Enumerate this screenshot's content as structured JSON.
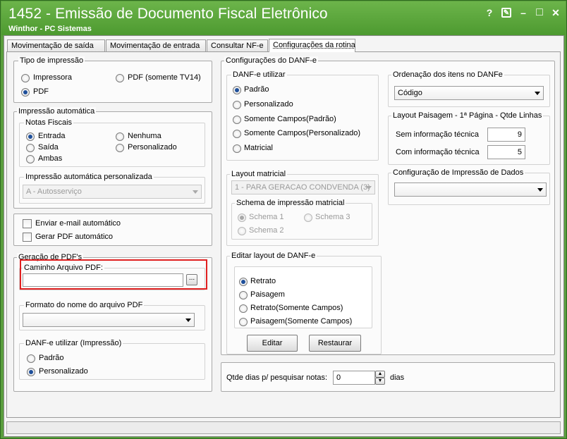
{
  "window": {
    "title": "1452 - Emissão de Documento Fiscal Eletrônico",
    "subtitle": "Winthor - PC Sistemas",
    "help": "?",
    "edit_icon": "✎",
    "minimize": "–",
    "maximize": "□",
    "close": "✕"
  },
  "tabs": [
    {
      "label": "Movimentação de saída"
    },
    {
      "label": "Movimentação de entrada"
    },
    {
      "label": "Consultar NF-e"
    },
    {
      "label": "Configurações da rotina"
    }
  ],
  "tipo_impressao": {
    "caption": "Tipo de impressão",
    "options": [
      {
        "label": "Impressora",
        "selected": false
      },
      {
        "label": "PDF (somente TV14)",
        "selected": false
      },
      {
        "label": "PDF",
        "selected": true
      }
    ]
  },
  "impressao_automatica": {
    "caption": "Impressão automática",
    "notas_caption": "Notas Fiscais",
    "options": [
      {
        "label": "Entrada",
        "selected": true
      },
      {
        "label": "Nenhuma",
        "selected": false
      },
      {
        "label": "Saída",
        "selected": false
      },
      {
        "label": "Personalizado",
        "selected": false
      },
      {
        "label": "Ambas",
        "selected": false
      }
    ],
    "personalizada_caption": "Impressão automática personalizada",
    "personalizada_value": "A - Autosserviço"
  },
  "email": {
    "enviar_label": "Enviar e-mail automático",
    "gerar_label": "Gerar PDF automático"
  },
  "geracao_pdf": {
    "caption": "Geração de PDF's",
    "caminho_caption": "Caminho Arquivo PDF:",
    "caminho_value": "",
    "browse_label": "...",
    "formato_caption": "Formato do nome do arquivo PDF",
    "formato_value": "",
    "danfe_caption": "DANF-e utilizar (Impressão)",
    "danfe_options": [
      {
        "label": "Padrão",
        "selected": false
      },
      {
        "label": "Personalizado",
        "selected": true
      }
    ]
  },
  "config_danfe": {
    "caption": "Configurações do DANF-e",
    "utilizar_caption": "DANF-e utilizar",
    "utilizar_options": [
      {
        "label": "Padrão",
        "selected": true
      },
      {
        "label": "Personalizado",
        "selected": false
      },
      {
        "label": "Somente Campos(Padrão)",
        "selected": false
      },
      {
        "label": "Somente Campos(Personalizado)",
        "selected": false
      },
      {
        "label": "Matricial",
        "selected": false
      }
    ],
    "layout_matricial_caption": "Layout matricial",
    "layout_matricial_value": "1 - PARA GERACAO CONDVENDA (3)",
    "schema_caption": "Schema de impressão matricial",
    "schema_options": [
      {
        "label": "Schema 1",
        "selected": true
      },
      {
        "label": "Schema 3",
        "selected": false
      },
      {
        "label": "Schema 2",
        "selected": false
      }
    ],
    "editar_caption": "Editar layout de DANF-e",
    "editar_options": [
      {
        "label": "Retrato",
        "selected": true
      },
      {
        "label": "Paisagem",
        "selected": false
      },
      {
        "label": "Retrato(Somente Campos)",
        "selected": false
      },
      {
        "label": "Paisagem(Somente Campos)",
        "selected": false
      }
    ],
    "editar_button": "Editar",
    "restaurar_button": "Restaurar"
  },
  "ordenacao": {
    "caption": "Ordenação dos itens no DANFe",
    "value": "Código"
  },
  "layout_paisagem": {
    "caption": "Layout Paisagem - 1ª Página - Qtde Linhas",
    "sem_label": "Sem informação técnica",
    "sem_value": "9",
    "com_label": "Com informação técnica",
    "com_value": "5"
  },
  "config_impressao": {
    "caption": "Configuração de Impressão de Dados",
    "value": ""
  },
  "qtde_dias": {
    "label": "Qtde dias p/ pesquisar notas:",
    "value": "0",
    "unit": "dias"
  },
  "colors": {
    "title_green": "#5a9e3e",
    "highlight_red": "#e02020",
    "radio_dot": "#1e4f9a"
  }
}
